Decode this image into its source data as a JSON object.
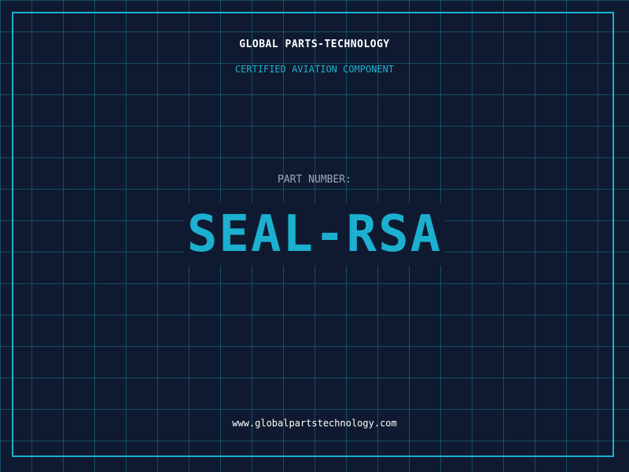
{
  "header": {
    "company": "GLOBAL PARTS-TECHNOLOGY",
    "subtitle": "CERTIFIED AVIATION COMPONENT"
  },
  "part": {
    "label": "PART NUMBER:",
    "number": "SEAL-RSA"
  },
  "footer": {
    "website": "www.globalpartstechnology.com"
  },
  "colors": {
    "background": "#0f1a30",
    "accent": "#1cb0d0",
    "grid": "#16788c",
    "muted_text": "#9aa7bb",
    "text": "#ffffff"
  }
}
